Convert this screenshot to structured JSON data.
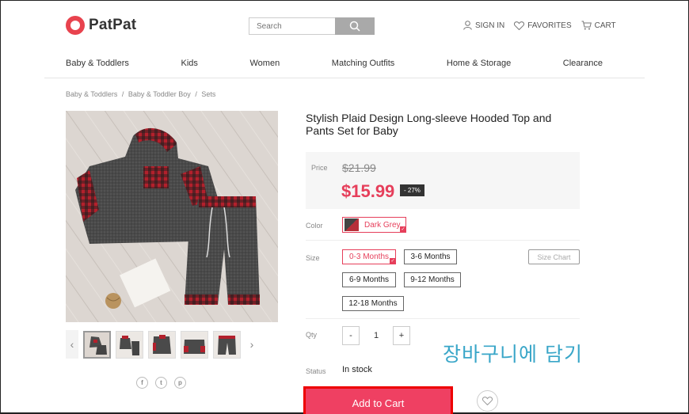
{
  "header": {
    "logo": "PatPat",
    "search_placeholder": "Search",
    "links": [
      "SIGN IN",
      "FAVORITES",
      "CART"
    ]
  },
  "nav": [
    "Baby & Toddlers",
    "Kids",
    "Women",
    "Matching Outfits",
    "Home & Storage",
    "Clearance"
  ],
  "breadcrumb": [
    "Baby & Toddlers",
    "/",
    "Baby & Toddler Boy",
    "/",
    "Sets"
  ],
  "product": {
    "title": "Stylish Plaid Design Long-sleeve Hooded Top and Pants Set for Baby",
    "price_label": "Price",
    "original_price": "$21.99",
    "sale_price": "$15.99",
    "discount": "- 27%",
    "color_label": "Color",
    "color_value": "Dark Grey",
    "size_label": "Size",
    "sizes": [
      "0-3 Months",
      "3-6 Months",
      "6-9 Months",
      "9-12 Months",
      "12-18 Months"
    ],
    "selected_size": "0-3 Months",
    "size_chart": "Size Chart",
    "qty_label": "Qty",
    "qty_minus": "-",
    "qty_value": "1",
    "qty_plus": "+",
    "status_label": "Status",
    "status_value": "In stock",
    "add_to_cart": "Add to Cart"
  },
  "overlay_text": "장바구니에 담기",
  "share": [
    "f",
    "t",
    "p"
  ],
  "gallery": {
    "prev": "‹",
    "next": "›"
  },
  "colors": {
    "accent": "#e63f5b",
    "button": "#ef4062",
    "overlay": "#39a6c8"
  }
}
